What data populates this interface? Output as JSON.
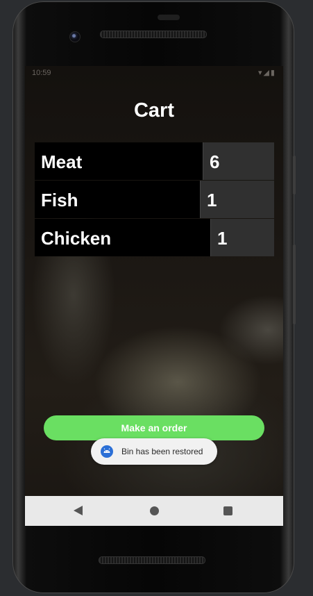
{
  "status_bar": {
    "time": "10:59",
    "icons": "▾◢▮"
  },
  "title": "Cart",
  "cart": {
    "items": [
      {
        "name": "Meat",
        "quantity": "6"
      },
      {
        "name": "Fish",
        "quantity": "1"
      },
      {
        "name": "Chicken",
        "quantity": "1"
      }
    ]
  },
  "order_button": {
    "label": "Make an order",
    "color": "#6adf62"
  },
  "toast": {
    "text": "Bin has been restored",
    "icon": "android-icon",
    "icon_color": "#2b6fd6"
  },
  "navbar": {
    "back": "back-icon",
    "home": "home-icon",
    "recents": "recents-icon"
  }
}
